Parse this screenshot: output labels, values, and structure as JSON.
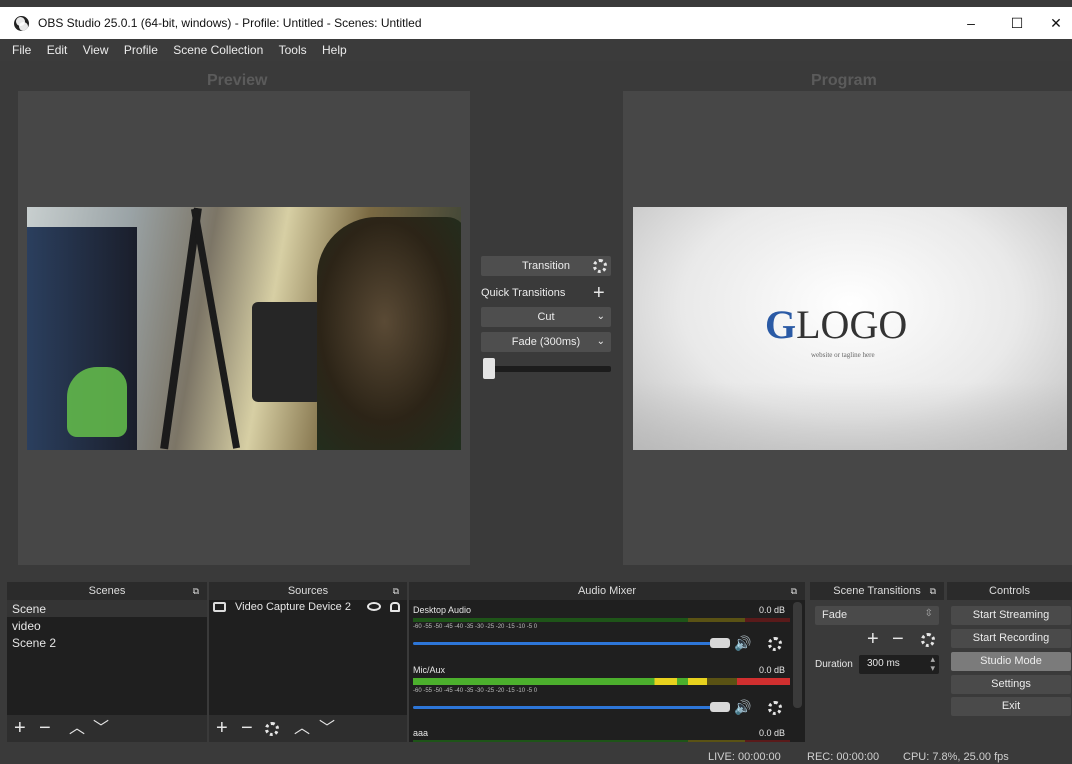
{
  "window": {
    "title": "OBS Studio 25.0.1 (64-bit, windows) - Profile: Untitled - Scenes: Untitled",
    "minimize": "–",
    "maximize": "☐",
    "close": "✕"
  },
  "menu": [
    "File",
    "Edit",
    "View",
    "Profile",
    "Scene Collection",
    "Tools",
    "Help"
  ],
  "preview": {
    "label": "Preview"
  },
  "program": {
    "label": "Program",
    "logo_text": "LOGO",
    "logo_letter": "G",
    "tagline": "website or tagline here"
  },
  "transition_panel": {
    "transition_label": "Transition",
    "quick_transitions_label": "Quick Transitions",
    "cut_label": "Cut",
    "fade_label": "Fade (300ms)",
    "tbar_value": 0
  },
  "scenes": {
    "title": "Scenes",
    "items": [
      "Scene",
      "video",
      "Scene 2"
    ]
  },
  "sources": {
    "title": "Sources",
    "items": [
      {
        "name": "Video Capture Device 2"
      }
    ]
  },
  "audio_mixer": {
    "title": "Audio Mixer",
    "channels": [
      {
        "name": "Desktop Audio",
        "db": "0.0 dB",
        "volume": 1.0
      },
      {
        "name": "Mic/Aux",
        "db": "0.0 dB",
        "volume": 1.0
      },
      {
        "name": "aaa",
        "db": "0.0 dB"
      }
    ],
    "ticks": "-60  -55  -50  -45  -40  -35  -30  -25  -20  -15  -10   -5    0"
  },
  "scene_transitions": {
    "title": "Scene Transitions",
    "selected": "Fade",
    "duration_label": "Duration",
    "duration_value": "300 ms"
  },
  "controls": {
    "title": "Controls",
    "start_streaming": "Start Streaming",
    "start_recording": "Start Recording",
    "studio_mode": "Studio Mode",
    "settings": "Settings",
    "exit": "Exit"
  },
  "status": {
    "live": "LIVE: 00:00:00",
    "rec": "REC: 00:00:00",
    "cpu": "CPU: 7.8%, 25.00 fps"
  },
  "colors": {
    "meter_green": "#4caf2d",
    "meter_yellow": "#e8d21e",
    "meter_red": "#d02f2f",
    "fader_blue": "#2d76d8"
  }
}
